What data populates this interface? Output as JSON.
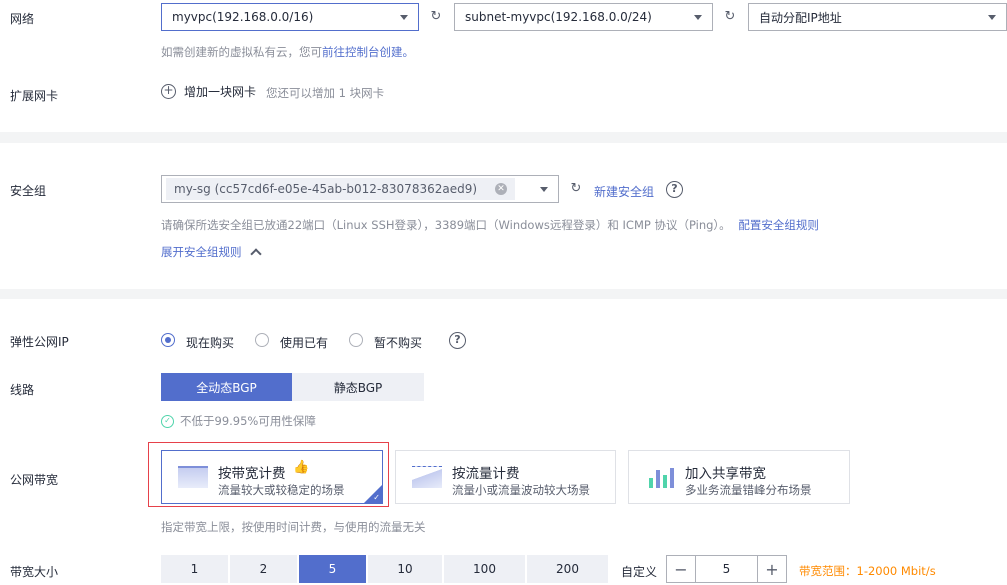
{
  "network": {
    "label": "网络",
    "vpc": "myvpc(192.168.0.0/16)",
    "subnet": "subnet-myvpc(192.168.0.0/24)",
    "ip": "自动分配IP地址",
    "hint": "如需创建新的虚拟私有云，您可",
    "hint_link": "前往控制台创建。"
  },
  "nic": {
    "label": "扩展网卡",
    "add": "增加一块网卡",
    "hint": "您还可以增加 1 块网卡"
  },
  "security": {
    "label": "安全组",
    "tag": "my-sg (cc57cd6f-e05e-45ab-b012-83078362aed9)",
    "new_link": "新建安全组",
    "hint": "请确保所选安全组已放通22端口（Linux SSH登录），3389端口（Windows远程登录）和 ICMP 协议（Ping）。",
    "hint_link": "配置安全组规则",
    "expand": "展开安全组规则"
  },
  "eip": {
    "label": "弹性公网IP",
    "options": [
      "现在购买",
      "使用已有",
      "暂不购买"
    ]
  },
  "line": {
    "label": "线路",
    "options": [
      "全动态BGP",
      "静态BGP"
    ],
    "guarantee": "不低于99.95%可用性保障"
  },
  "bandwidth": {
    "label": "公网带宽",
    "cards": [
      {
        "title": "按带宽计费",
        "sub": "流量较大或较稳定的场景"
      },
      {
        "title": "按流量计费",
        "sub": "流量小或流量波动较大场景"
      },
      {
        "title": "加入共享带宽",
        "sub": "多业务流量错峰分布场景"
      }
    ],
    "hint": "指定带宽上限，按使用时间计费，与使用的流量无关"
  },
  "size": {
    "label": "带宽大小",
    "options": [
      "1",
      "2",
      "5",
      "10",
      "100",
      "200"
    ],
    "custom": "自定义",
    "minus": "−",
    "value": "5",
    "plus": "+",
    "range": "带宽范围：1-2000 Mbit/s"
  },
  "colors": {
    "accent": "#526ecc",
    "orange": "#ff8a00",
    "green": "#50d4ab",
    "red": "#e6414a"
  }
}
